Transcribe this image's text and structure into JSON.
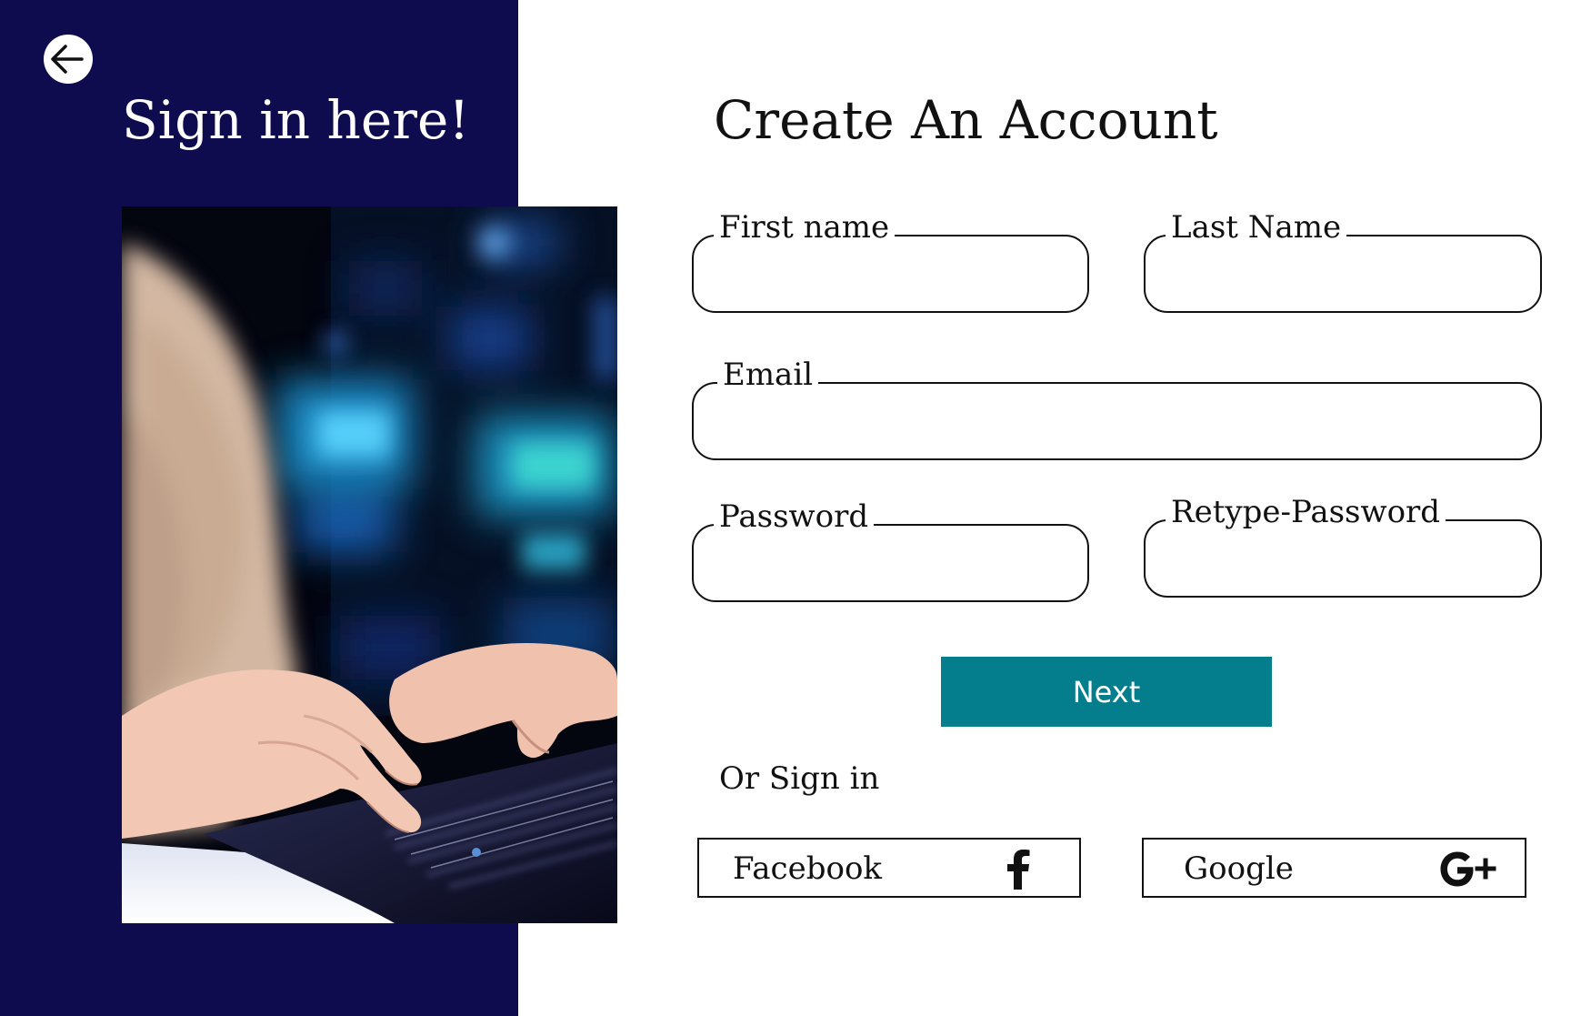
{
  "left_panel": {
    "back_icon": "arrow-left-icon",
    "heading": "Sign in here!",
    "photo_description": "laptop-typing-photo"
  },
  "form": {
    "title": "Create An Account",
    "fields": {
      "first_name": {
        "label": "First name",
        "value": "",
        "placeholder": ""
      },
      "last_name": {
        "label": "Last Name",
        "value": "",
        "placeholder": ""
      },
      "email": {
        "label": "Email",
        "value": "",
        "placeholder": ""
      },
      "password": {
        "label": "Password",
        "value": "",
        "placeholder": ""
      },
      "retype_password": {
        "label": "Retype-Password",
        "value": "",
        "placeholder": ""
      }
    },
    "next_label": "Next",
    "or_sign_in": "Or Sign in",
    "social": {
      "facebook": {
        "label": "Facebook",
        "icon": "facebook-icon"
      },
      "google": {
        "label": "Google",
        "icon": "google-plus-icon"
      }
    }
  },
  "colors": {
    "panel_bg": "#0e0c4f",
    "accent": "#047e8c",
    "text": "#111111",
    "background": "#ffffff"
  }
}
